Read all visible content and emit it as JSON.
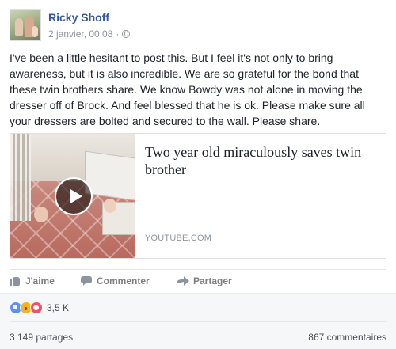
{
  "post": {
    "author": "Ricky Shoff",
    "timestamp": "2 janvier, 00:08",
    "privacy_icon": "globe-icon",
    "text": "I've been a little hesitant to post this. But I feel it's not only to bring awareness, but it is also incredible. We are so grateful for the bond that these twin brothers share. We know Bowdy was not alone in moving the dresser off of Brock. And feel blessed that he is ok. Please make sure all your dressers are bolted and secured to the wall. Please share."
  },
  "link_card": {
    "title": "Two year old miraculously saves twin brother",
    "domain": "YOUTUBE.COM",
    "play_icon": "play-icon"
  },
  "actions": {
    "like": "J'aime",
    "comment": "Commenter",
    "share": "Partager"
  },
  "stats": {
    "reaction_count": "3,5 K",
    "shares": "3 149 partages",
    "comments": "867 commentaires",
    "reaction_types": [
      "like",
      "wow",
      "love"
    ]
  },
  "colors": {
    "author_link": "#365899",
    "meta_gray": "#90949c",
    "like_blue": "#5890ff",
    "wow_yellow": "#f7b125",
    "love_red": "#f25268",
    "footer_bg": "#f6f7f9"
  }
}
